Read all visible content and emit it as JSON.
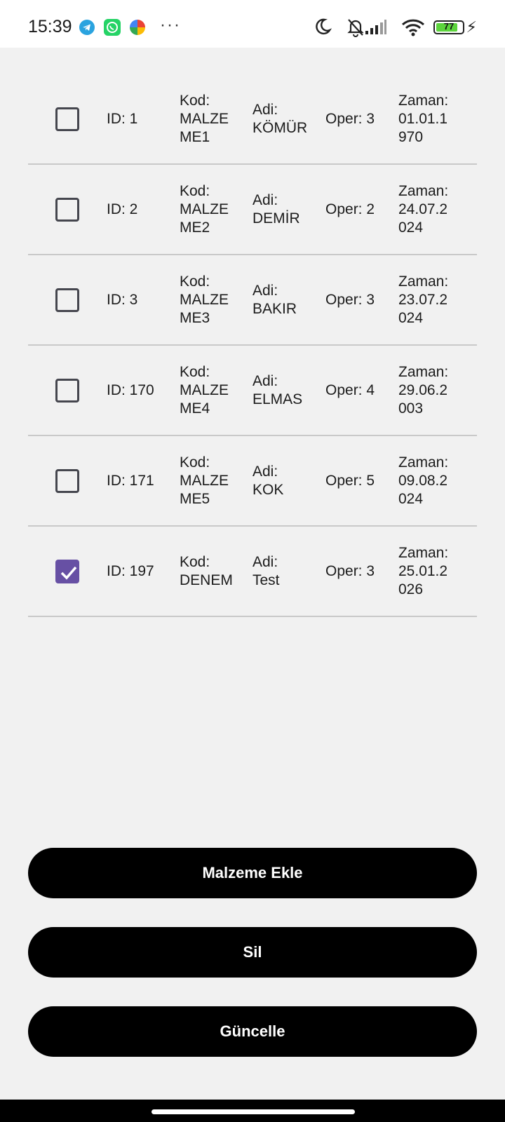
{
  "status_bar": {
    "time": "15:39",
    "battery_level": "77",
    "icons": [
      "telegram-icon",
      "whatsapp-icon",
      "photos-icon",
      "more-icon",
      "moon-icon",
      "bell-off-icon",
      "signal-icon",
      "wifi-icon",
      "battery-icon",
      "charging-icon"
    ]
  },
  "colors": {
    "accent": "#6750a4",
    "button": "#000000",
    "background": "#f1f1f1"
  },
  "rows": [
    {
      "checked": false,
      "id": "ID: 1",
      "kod": "Kod:\nMALZE\nME1",
      "adi": "Adi:\nKÖMÜR",
      "oper": "Oper: 3",
      "zaman": "Zaman:\n01.01.1\n970"
    },
    {
      "checked": false,
      "id": "ID: 2",
      "kod": "Kod:\nMALZE\nME2",
      "adi": "Adi:\nDEMİR",
      "oper": "Oper: 2",
      "zaman": "Zaman:\n24.07.2\n024"
    },
    {
      "checked": false,
      "id": "ID: 3",
      "kod": "Kod:\nMALZE\nME3",
      "adi": "Adi:\nBAKIR",
      "oper": "Oper: 3",
      "zaman": "Zaman:\n23.07.2\n024"
    },
    {
      "checked": false,
      "id": "ID: 170",
      "kod": "Kod:\nMALZE\nME4",
      "adi": "Adi:\nELMAS",
      "oper": "Oper: 4",
      "zaman": "Zaman:\n29.06.2\n003"
    },
    {
      "checked": false,
      "id": "ID: 171",
      "kod": "Kod:\nMALZE\nME5",
      "adi": "Adi:\nKOK",
      "oper": "Oper: 5",
      "zaman": "Zaman:\n09.08.2\n024"
    },
    {
      "checked": true,
      "id": "ID: 197",
      "kod": "Kod:\nDENEM",
      "adi": "Adi:\nTest",
      "oper": "Oper: 3",
      "zaman": "Zaman:\n25.01.2\n026"
    }
  ],
  "buttons": {
    "add": "Malzeme Ekle",
    "delete": "Sil",
    "update": "Güncelle"
  }
}
